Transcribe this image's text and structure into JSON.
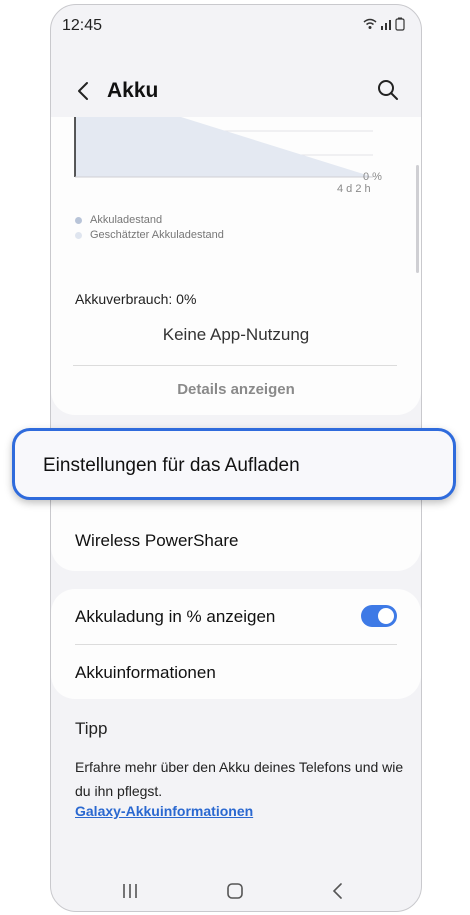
{
  "status_bar": {
    "time": "12:45",
    "icons": "wifi signal battery"
  },
  "header": {
    "title": "Akku"
  },
  "battery_card": {
    "chart_percent_label": "0 %",
    "chart_time_label": "4 d 2 h",
    "legend": [
      {
        "label": "Akkuladestand",
        "color": "#b8c4d8"
      },
      {
        "label": "Geschätzter Akkuladestand",
        "color": "#dfe5ef"
      }
    ],
    "usage_label": "Akkuverbrauch: 0%",
    "no_app_label": "Keine App-Nutzung",
    "details_button": "Details anzeigen"
  },
  "highlighted_item": {
    "label": "Einstellungen für das Aufladen"
  },
  "powershare": {
    "label": "Wireless PowerShare"
  },
  "settings": {
    "show_percent_label": "Akkuladung in % anzeigen",
    "show_percent_enabled": true,
    "info_label": "Akkuinformationen"
  },
  "tip": {
    "heading": "Tipp",
    "text": "Erfahre mehr über den Akku deines Telefons und wie du ihn pflegst.",
    "link": "Galaxy-Akkuinformationen"
  },
  "colors": {
    "accent": "#2f6bdc",
    "toggle": "#3e7ae6",
    "link": "#2a68d0"
  }
}
